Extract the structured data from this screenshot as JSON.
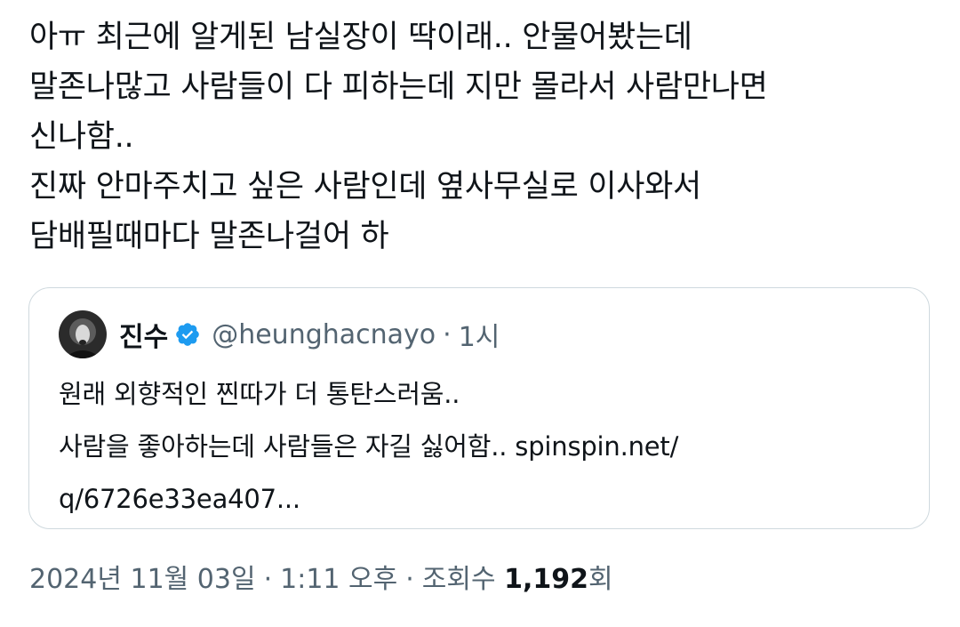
{
  "tweet": {
    "lines": [
      "아ㅠ 최근에 알게된 남실장이 딱이래.. 안물어봤는데",
      "말존나많고 사람들이 다 피하는데 지만 몰라서 사람만나면",
      "신나함..",
      "진짜 안마주치고 싶은 사람인데 옆사무실로 이사와서",
      "담배필때마다 말존나걸어 하"
    ]
  },
  "quote": {
    "author_name": "진수",
    "verified_icon": "verified-badge-icon",
    "handle": "@heunghacnayo",
    "separator": "·",
    "time": "1시",
    "lines": [
      "원래 외향적인 찐따가 더 통탄스러움..",
      "사람을 좋아하는데 사람들은 자길 싫어함.. spinspin.net/",
      "q/6726e33ea407..."
    ]
  },
  "meta": {
    "date": "2024년 11월 03일",
    "dot1": "·",
    "time": "1:11 오후",
    "dot2": "·",
    "views_label": "조회수",
    "views_count": "1,192",
    "views_suffix": "회"
  },
  "colors": {
    "text": "#0f1419",
    "secondary": "#536471",
    "border": "#cfd9de",
    "verified": "#1d9bf0"
  }
}
